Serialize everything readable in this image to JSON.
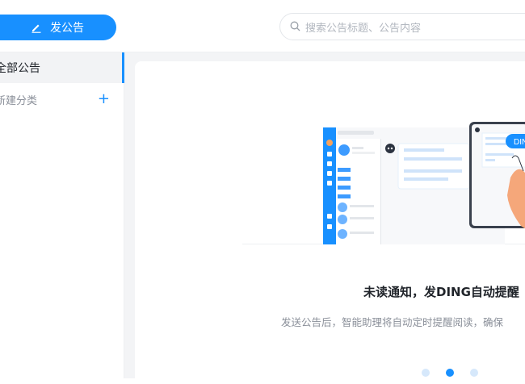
{
  "toolbar": {
    "post_label": "发公告"
  },
  "search": {
    "placeholder": "搜索公告标题、公告内容"
  },
  "sidebar": {
    "items": [
      {
        "label": "全部公告",
        "selected": true
      },
      {
        "label": "新建分类",
        "action_icon": "plus-icon"
      }
    ]
  },
  "onboarding": {
    "title": "未读通知，发DING自动提醒",
    "description": "发送公告后，智能助理将自动定时提醒阅读，确保",
    "illustration_badge": "DING",
    "carousel": {
      "total": 3,
      "active_index": 1
    }
  },
  "colors": {
    "accent": "#1890ff",
    "background": "#f3f4f6"
  }
}
